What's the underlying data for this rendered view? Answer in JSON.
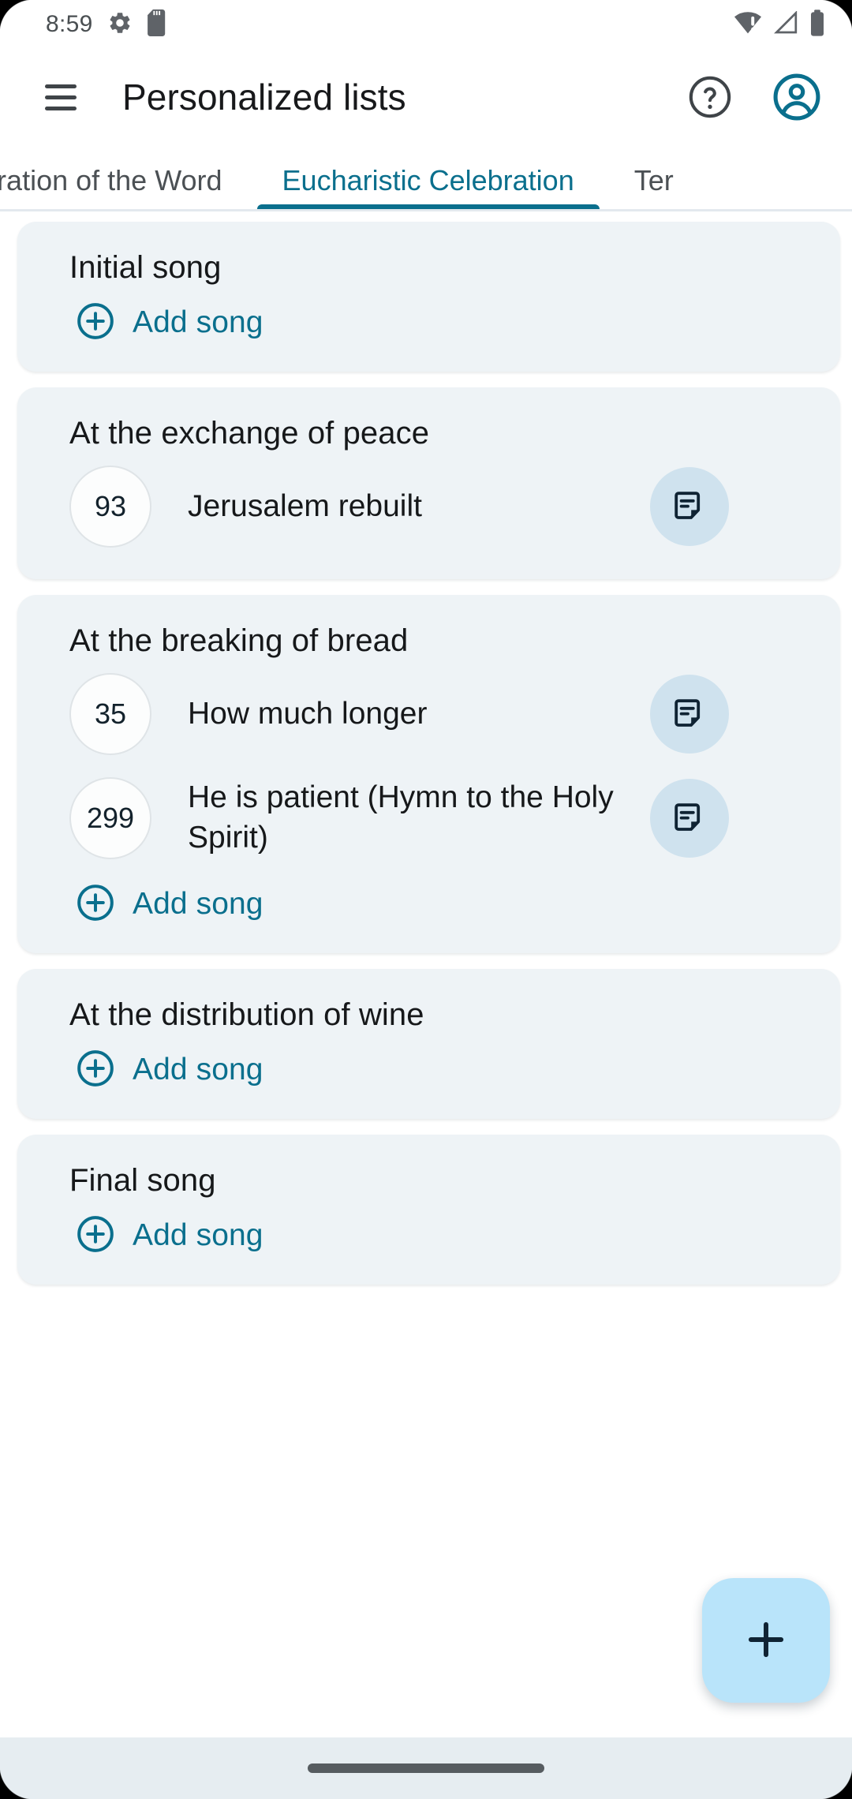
{
  "status_bar": {
    "time": "8:59",
    "left_icons": [
      "gear-icon",
      "sd-card-icon"
    ],
    "right_icons": [
      "wifi-alert-icon",
      "cellular-signal-icon",
      "battery-icon"
    ]
  },
  "app_bar": {
    "menu_icon": "hamburger-menu-icon",
    "title": "Personalized lists",
    "help_icon": "help-circle-icon",
    "account_icon": "account-circle-icon",
    "accent_color": "#0a6f8d"
  },
  "tabs": [
    {
      "label": "Celebration of the Word",
      "active": false
    },
    {
      "label": "Eucharistic Celebration",
      "active": true
    },
    {
      "label": "Ter",
      "active": false
    }
  ],
  "cards": [
    {
      "title": "Initial song",
      "songs": [],
      "add_song_label": "Add song"
    },
    {
      "title": "At the exchange of peace",
      "songs": [
        {
          "number": "93",
          "title": "Jerusalem rebuilt",
          "note_icon": "sticky-note-icon"
        }
      ],
      "add_song_label": null
    },
    {
      "title": "At the breaking of bread",
      "songs": [
        {
          "number": "35",
          "title": "How much longer",
          "note_icon": "sticky-note-icon"
        },
        {
          "number": "299",
          "title": "He is patient (Hymn to the Holy Spirit)",
          "note_icon": "sticky-note-icon"
        }
      ],
      "add_song_label": "Add song"
    },
    {
      "title": "At the distribution of wine",
      "songs": [],
      "add_song_label": "Add song"
    },
    {
      "title": "Final song",
      "songs": [],
      "add_song_label": "Add song"
    }
  ],
  "fab": {
    "icon": "plus-icon",
    "background_color": "#b9e4fa"
  },
  "nav_bar": {
    "handle": "gesture-home-handle"
  },
  "colors": {
    "card_background": "#eef3f6",
    "accent": "#0a6f8d",
    "note_button_background": "#cfe2ee",
    "page_background": "#ffffff"
  }
}
